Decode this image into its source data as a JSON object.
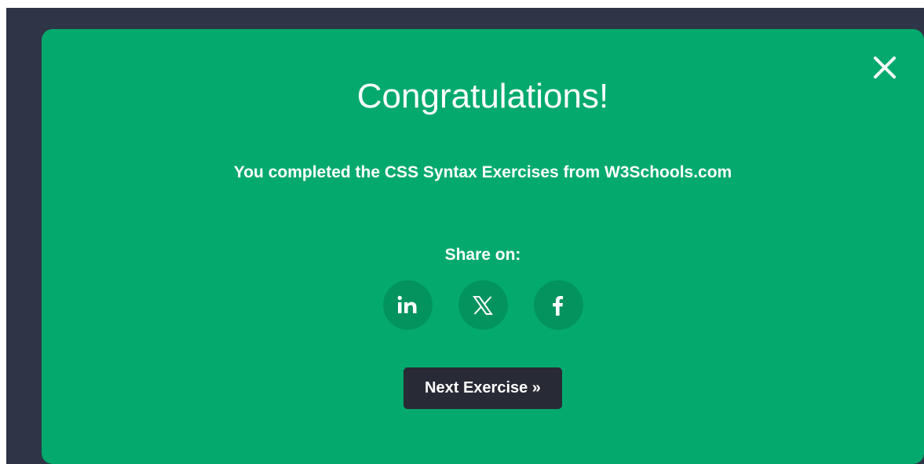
{
  "modal": {
    "title": "Congratulations!",
    "message": "You completed the CSS Syntax Exercises from W3Schools.com",
    "share_label": "Share on:",
    "share_buttons": [
      {
        "icon": "linkedin-icon",
        "label": "in"
      },
      {
        "icon": "x-twitter-icon",
        "label": "𝕏"
      },
      {
        "icon": "facebook-icon",
        "label": "f"
      }
    ],
    "next_button_label": "Next Exercise »",
    "close_icon": "close-icon"
  },
  "colors": {
    "backdrop": "#2d3547",
    "modal_background": "#04aa6d",
    "share_button_background": "#03935e",
    "next_button_background": "#282a35",
    "text": "#ffffff"
  }
}
